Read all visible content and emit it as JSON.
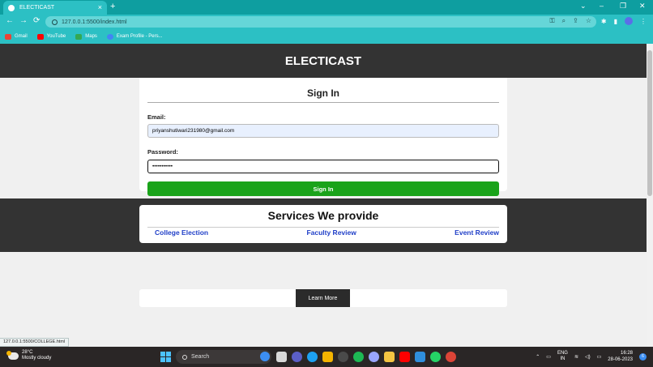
{
  "browser": {
    "tab_title": "ELECTICAST",
    "tab_close": "×",
    "new_tab": "+",
    "url": "127.0.0.1:5500/index.html",
    "window_controls": {
      "dropdown": "⌄",
      "minimize": "–",
      "restore": "❐",
      "close": "✕"
    },
    "nav": {
      "back": "←",
      "forward": "→",
      "reload": "⟳"
    },
    "bookmarks": [
      {
        "label": "Gmail",
        "color": "#ea4335"
      },
      {
        "label": "YouTube",
        "color": "#ff0000"
      },
      {
        "label": "Maps",
        "color": "#34a853"
      },
      {
        "label": "Exam Profile - Pers...",
        "color": "#4285f4"
      }
    ],
    "status_url": "127.0.0.1:5500/COLLEGE.html"
  },
  "page": {
    "site_title": "ELECTICAST",
    "signin": {
      "heading": "Sign In",
      "email_label": "Email:",
      "email_value": "priyanshutiwari231980@gmail.com",
      "password_label": "Password:",
      "password_value": "•••••••••••",
      "button_label": "Sign In"
    },
    "services": {
      "heading": "Services We provide",
      "items": [
        "College Election",
        "Faculty Review",
        "Event Review"
      ]
    },
    "learn_more_label": "Learn More"
  },
  "taskbar": {
    "weather_temp": "28°C",
    "weather_desc": "Mostly cloudy",
    "search_placeholder": "Search",
    "lang_line1": "ENG",
    "lang_line2": "IN",
    "time": "16:28",
    "date": "28-06-2023",
    "notification_count": "6",
    "app_icon_colors": [
      "#d9d9d9",
      "#5b5fc7",
      "#1da1f2",
      "#f4b400",
      "#2a2a2a",
      "#1db954",
      "#9aa6ff",
      "#f4c542",
      "#ff0000",
      "#2f8fdd",
      "#25d366",
      "#db4437"
    ]
  }
}
